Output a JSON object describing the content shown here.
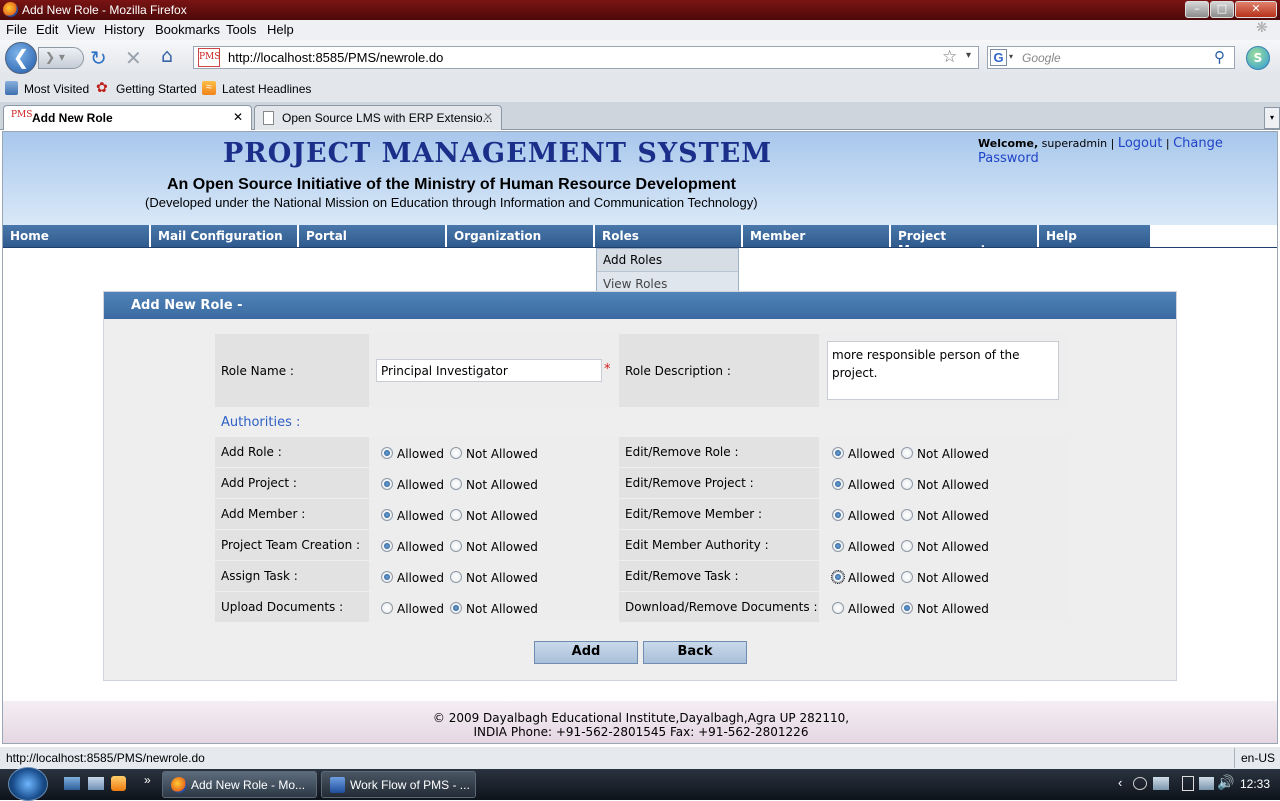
{
  "window": {
    "title": "Add New Role - Mozilla Firefox"
  },
  "menu": [
    "File",
    "Edit",
    "View",
    "History",
    "Bookmarks",
    "Tools",
    "Help"
  ],
  "nav": {
    "url": "http://localhost:8585/PMS/newrole.do",
    "search_placeholder": "Google",
    "site_icon_text": "PMS"
  },
  "bookmarks": [
    "Most Visited",
    "Getting Started",
    "Latest Headlines"
  ],
  "tabs": [
    {
      "label": "Add New Role",
      "icon_text": "PMS"
    },
    {
      "label": "Open Source LMS with ERP Extensio..."
    }
  ],
  "header": {
    "title": "PROJECT MANAGEMENT SYSTEM",
    "subtitle": "An Open Source Initiative of the Ministry of Human Resource Development",
    "subtitle2": "(Developed under the National Mission on Education through Information and Communication Technology)",
    "welcome_label": "Welcome,",
    "user": "superadmin",
    "sep": "|",
    "logout": "Logout",
    "change_password": "Change Password"
  },
  "mainnav": [
    "Home",
    "Mail Configuration",
    "Portal",
    "Organization",
    "Roles",
    "Member",
    "Project Management",
    "Help"
  ],
  "dropdown": [
    "Add Roles",
    "View Roles"
  ],
  "form": {
    "heading": "Add New Role -",
    "role_name_label": "Role Name :",
    "role_name_value": "Principal Investigator",
    "required_mark": "*",
    "role_desc_label": "Role Description :",
    "role_desc_value": "more responsible person of the project.",
    "authorities_label": "Authorities :",
    "allowed": "Allowed",
    "not_allowed": "Not Allowed",
    "rows": [
      {
        "left": "Add Role :",
        "left_value": "Allowed",
        "right": "Edit/Remove Role :",
        "right_value": "Allowed"
      },
      {
        "left": "Add Project :",
        "left_value": "Allowed",
        "right": "Edit/Remove Project :",
        "right_value": "Allowed"
      },
      {
        "left": "Add Member :",
        "left_value": "Allowed",
        "right": "Edit/Remove Member :",
        "right_value": "Allowed"
      },
      {
        "left": "Project Team Creation :",
        "left_value": "Allowed",
        "right": "Edit Member Authority :",
        "right_value": "Allowed"
      },
      {
        "left": "Assign Task :",
        "left_value": "Allowed",
        "right": "Edit/Remove Task :",
        "right_value": "Allowed"
      },
      {
        "left": "Upload Documents :",
        "left_value": "Not Allowed",
        "right": "Download/Remove Documents :",
        "right_value": "Not Allowed"
      }
    ],
    "add_button": "Add",
    "back_button": "Back"
  },
  "footer": {
    "line1": "© 2009 Dayalbagh Educational Institute,Dayalbagh,Agra UP 282110,",
    "line2": "INDIA Phone: +91-562-2801545 Fax: +91-562-2801226"
  },
  "status": {
    "url": "http://localhost:8585/PMS/newrole.do",
    "locale": "en-US"
  },
  "taskbar": {
    "tasks": [
      "Add New Role - Mo...",
      "Work Flow of PMS - ..."
    ],
    "clock": "12:33"
  }
}
